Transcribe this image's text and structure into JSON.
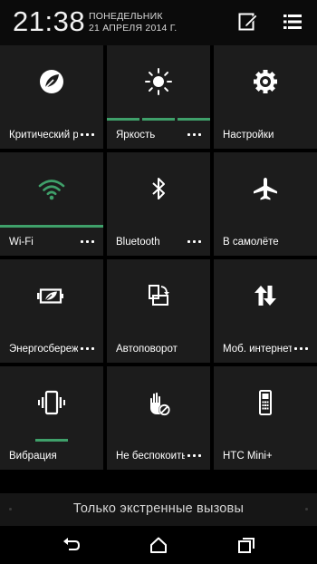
{
  "status": {
    "time": "21:38",
    "day": "ПОНЕДЕЛЬНИК",
    "date": "21 АПРЕЛЯ 2014 Г."
  },
  "header_icons": [
    "edit-icon",
    "list-icon"
  ],
  "tiles": [
    {
      "label": "Критический р",
      "icon": "leaf-icon",
      "more": true
    },
    {
      "label": "Яркость",
      "icon": "sun-icon",
      "more": true,
      "level": "3 of 3 segments lit"
    },
    {
      "label": "Настройки",
      "icon": "gear-icon",
      "more": false
    },
    {
      "label": "Wi-Fi",
      "icon": "wifi-icon",
      "more": true,
      "active": true
    },
    {
      "label": "Bluetooth",
      "icon": "bluetooth-icon",
      "more": true
    },
    {
      "label": "В самолёте",
      "icon": "airplane-icon",
      "more": false
    },
    {
      "label": "Энергосбереж",
      "icon": "battery-leaf-icon",
      "more": true
    },
    {
      "label": "Автоповорот",
      "icon": "rotate-icon",
      "more": false
    },
    {
      "label": "Моб. интернет",
      "icon": "data-arrows-icon",
      "more": true
    },
    {
      "label": "Вибрация",
      "icon": "vibrate-icon",
      "more": false,
      "active": true
    },
    {
      "label": "Не беспокоить",
      "icon": "do-not-disturb-hand-icon",
      "more": true
    },
    {
      "label": "HTC Mini+",
      "icon": "htc-mini-phone-icon",
      "more": false
    }
  ],
  "emergency_text": "Только экстренные вызовы",
  "nav": [
    "back-icon",
    "home-icon",
    "recents-icon"
  ],
  "colors": {
    "accent": "#3fa06a",
    "tile": "#1c1c1c",
    "background": "#000000"
  }
}
